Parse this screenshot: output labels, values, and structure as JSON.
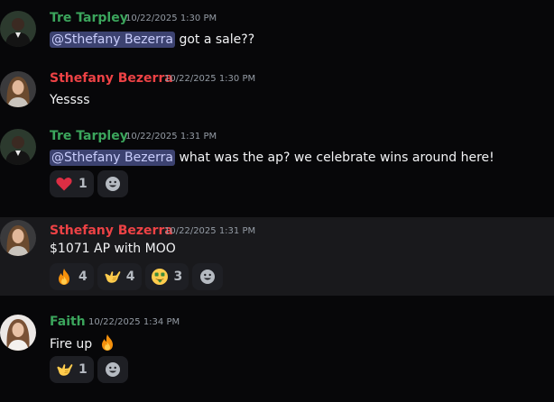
{
  "messages": [
    {
      "author": "Tre Tarpley",
      "author_color": "#3ba55c",
      "timestamp": "10/22/2025 1:30 PM",
      "mention": "@Sthefany Bezerra",
      "text": " got a sale??"
    },
    {
      "author": "Sthefany Bezerra",
      "author_color": "#ed4245",
      "timestamp": "10/22/2025 1:30 PM",
      "text": "Yessss"
    },
    {
      "author": "Tre Tarpley",
      "author_color": "#3ba55c",
      "timestamp": "10/22/2025 1:31 PM",
      "mention": "@Sthefany Bezerra",
      "text": " what was the ap? we celebrate wins around here!",
      "reactions": [
        {
          "emoji": "heart-icon",
          "count": "1"
        }
      ]
    },
    {
      "author": "Sthefany Bezerra",
      "author_color": "#ed4245",
      "timestamp": "10/22/2025 1:31 PM",
      "text": "$1071 AP with MOO",
      "reactions": [
        {
          "emoji": "fire-icon",
          "count": "4"
        },
        {
          "emoji": "call-me-hand-icon",
          "count": "4"
        },
        {
          "emoji": "money-mouth-face-icon",
          "count": "3"
        }
      ]
    },
    {
      "author": "Faith",
      "author_color": "#3ba55c",
      "timestamp": "10/22/2025 1:34 PM",
      "text": "Fire up",
      "inline_emoji": "fire-icon",
      "reactions": [
        {
          "emoji": "call-me-hand-icon",
          "count": "1"
        }
      ]
    }
  ],
  "add_reaction_icon": "smiley-add-reaction-icon"
}
